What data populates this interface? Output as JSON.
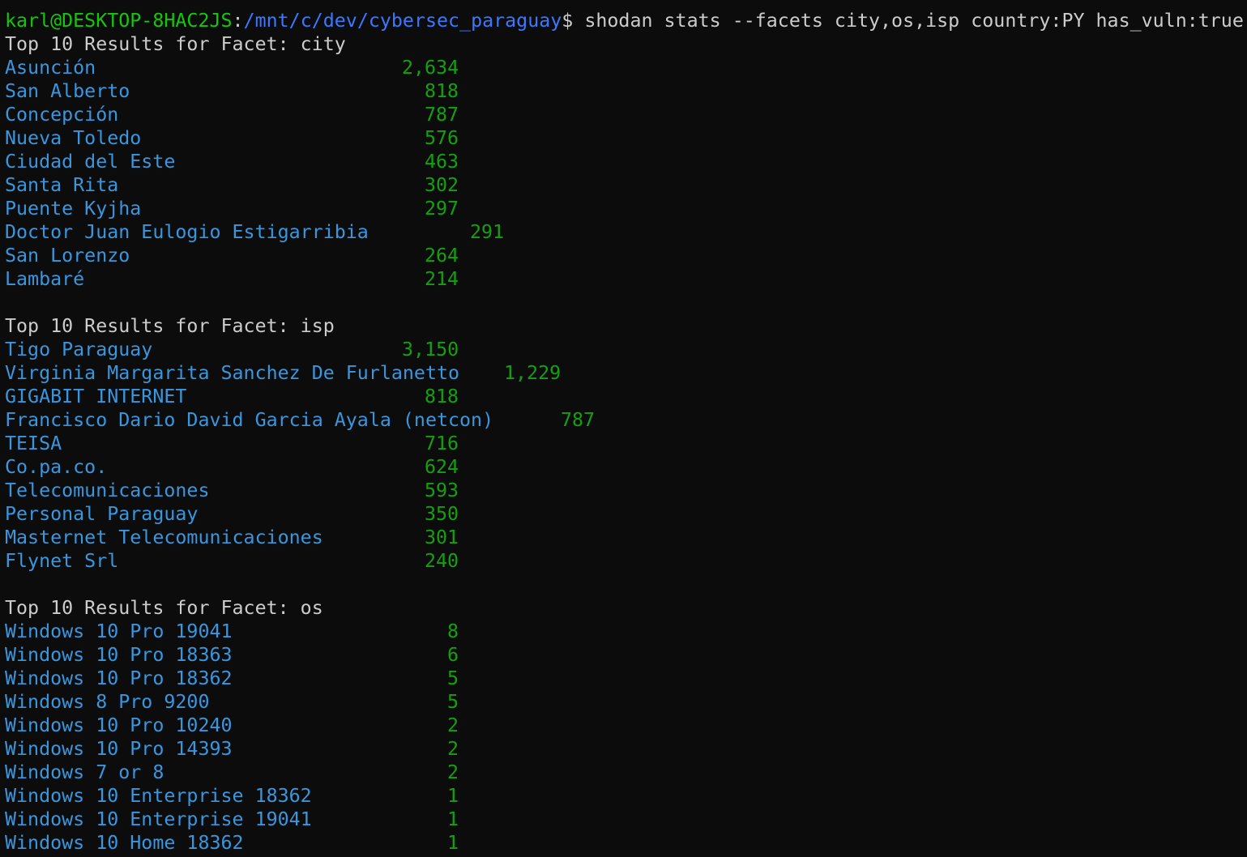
{
  "prompt": {
    "user_host": "karl@DESKTOP-8HAC2JS",
    "separator": ":",
    "path": "/mnt/c/dev/cybersec_paraguay",
    "symbol": "$",
    "command": " shodan stats --facets city,os,isp country:PY has_vuln:true"
  },
  "sections": [
    {
      "header": "Top 10 Results for Facet: city",
      "rows": [
        {
          "key": "Asunción",
          "value": "2,634"
        },
        {
          "key": "San Alberto",
          "value": "818"
        },
        {
          "key": "Concepción",
          "value": "787"
        },
        {
          "key": "Nueva Toledo",
          "value": "576"
        },
        {
          "key": "Ciudad del Este",
          "value": "463"
        },
        {
          "key": "Santa Rita",
          "value": "302"
        },
        {
          "key": "Puente Kyjha",
          "value": "297"
        },
        {
          "key": "Doctor Juan Eulogio Estigarribia",
          "value": "291"
        },
        {
          "key": "San Lorenzo",
          "value": "264"
        },
        {
          "key": "Lambaré",
          "value": "214"
        }
      ]
    },
    {
      "header": "Top 10 Results for Facet: isp",
      "rows": [
        {
          "key": "Tigo Paraguay",
          "value": "3,150"
        },
        {
          "key": "Virginia Margarita Sanchez De Furlanetto",
          "value": "1,229"
        },
        {
          "key": "GIGABIT INTERNET",
          "value": "818"
        },
        {
          "key": "Francisco Dario David Garcia Ayala (netcon)",
          "value": "787"
        },
        {
          "key": "TEISA",
          "value": "716"
        },
        {
          "key": "Co.pa.co.",
          "value": "624"
        },
        {
          "key": "Telecomunicaciones",
          "value": "593"
        },
        {
          "key": "Personal Paraguay",
          "value": "350"
        },
        {
          "key": "Masternet Telecomunicaciones",
          "value": "301"
        },
        {
          "key": "Flynet Srl",
          "value": "240"
        }
      ]
    },
    {
      "header": "Top 10 Results for Facet: os",
      "rows": [
        {
          "key": "Windows 10 Pro 19041",
          "value": "8"
        },
        {
          "key": "Windows 10 Pro 18363",
          "value": "6"
        },
        {
          "key": "Windows 10 Pro 18362",
          "value": "5"
        },
        {
          "key": "Windows 8 Pro 9200",
          "value": "5"
        },
        {
          "key": "Windows 10 Pro 10240",
          "value": "2"
        },
        {
          "key": "Windows 10 Pro 14393",
          "value": "2"
        },
        {
          "key": "Windows 7 or 8",
          "value": "2"
        },
        {
          "key": "Windows 10 Enterprise 18362",
          "value": "1"
        },
        {
          "key": "Windows 10 Enterprise 19041",
          "value": "1"
        },
        {
          "key": "Windows 10 Home 18362",
          "value": "1"
        }
      ]
    }
  ],
  "colors": {
    "background": "#0c0c0c",
    "foreground": "#cccccc",
    "prompt_user": "#16c60c",
    "prompt_path": "#3b78ff",
    "facet_key": "#3a96dd",
    "facet_value": "#13a10e"
  }
}
